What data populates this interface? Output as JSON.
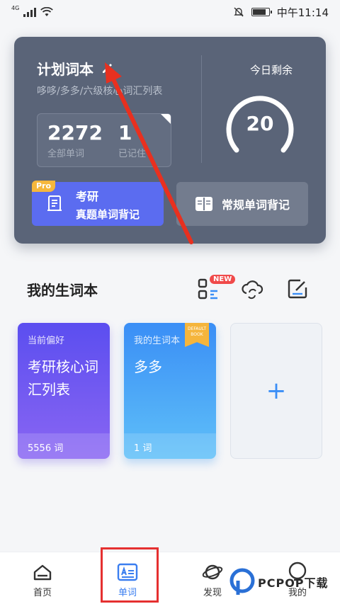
{
  "status": {
    "network": "4G",
    "time": "中午11:14"
  },
  "plan": {
    "title": "计划词本",
    "subtitle": "哆哆/多多/六级核心词汇列表",
    "stats": [
      {
        "value": "2272",
        "label": "全部单词"
      },
      {
        "value": "1",
        "label": "已记住"
      }
    ],
    "remaining_label": "今日剩余",
    "remaining_value": "20",
    "btn_kaoyan": {
      "badge": "Pro",
      "line1": "考研",
      "line2": "真题单词背记"
    },
    "btn_normal": "常规单词背记"
  },
  "vocab": {
    "title": "我的生词本",
    "new_badge": "NEW",
    "cards": [
      {
        "tag": "当前偏好",
        "name": "考研核心词汇列表",
        "count": "5556 词"
      },
      {
        "tag": "我的生词本",
        "name": "多多",
        "count": "1 词",
        "ribbon": "DEFAULT BOOK"
      }
    ],
    "add_label": "+"
  },
  "nav": [
    {
      "label": "首页"
    },
    {
      "label": "单词"
    },
    {
      "label": "发现"
    },
    {
      "label": "我的"
    }
  ],
  "watermark": "PCPOP下载",
  "colors": {
    "accent": "#3a7ef0",
    "card_bg": "#5a6478",
    "pro": "#f6b73c",
    "highlight": "#e53030"
  }
}
